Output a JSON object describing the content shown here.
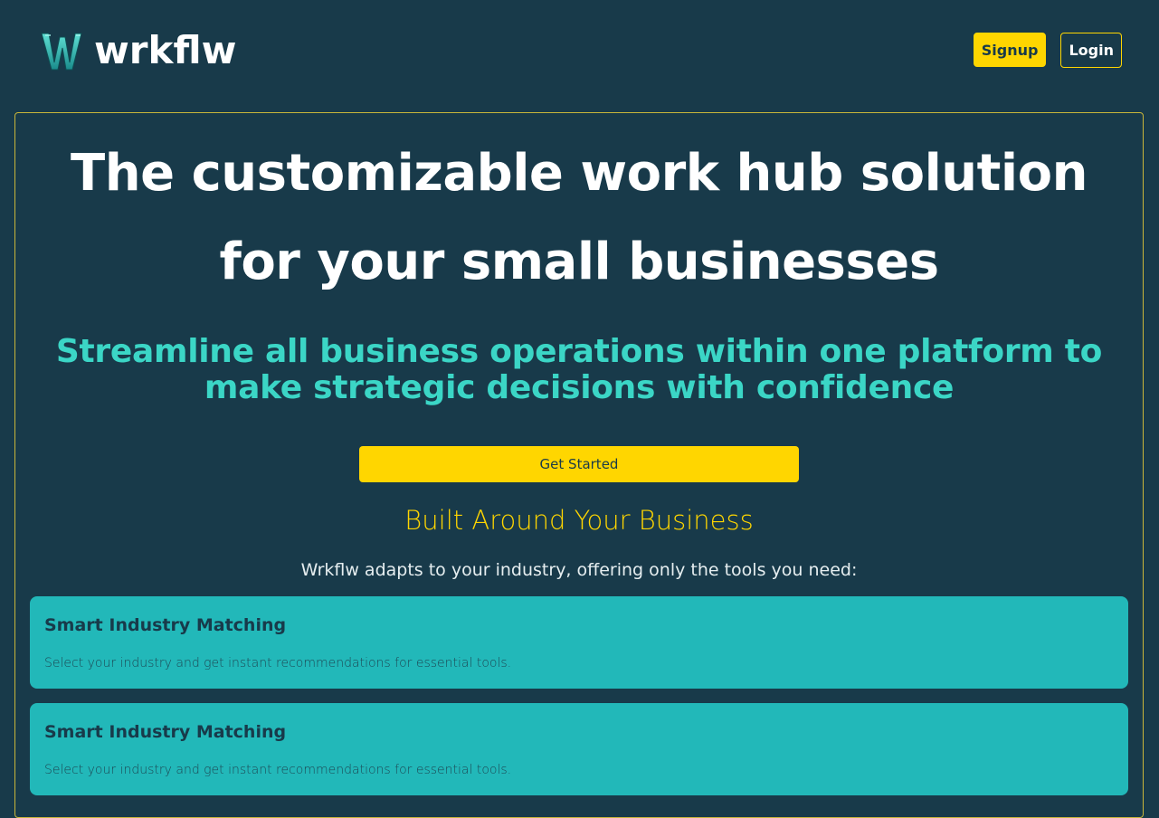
{
  "brand": {
    "name": "wrkflw",
    "mark": "W",
    "accent": "#ffd600",
    "teal": "#3bd6c6",
    "background": "#183a4a"
  },
  "nav": {
    "signup_label": "Signup",
    "login_label": "Login"
  },
  "hero": {
    "title": "The customizable work hub solution for your small businesses",
    "subtitle": "Streamline all business operations within one platform to make strategic decisions with confidence",
    "cta_label": "Get Started"
  },
  "features": {
    "title": "Built Around Your Business",
    "description": "Wrkflw adapts to your industry, offering only the tools you need:",
    "cards": [
      {
        "title": "Smart Industry Matching",
        "description": "Select your industry and get instant recommendations for essential tools."
      },
      {
        "title": "Smart Industry Matching",
        "description": "Select your industry and get instant recommendations for essential tools."
      }
    ]
  }
}
